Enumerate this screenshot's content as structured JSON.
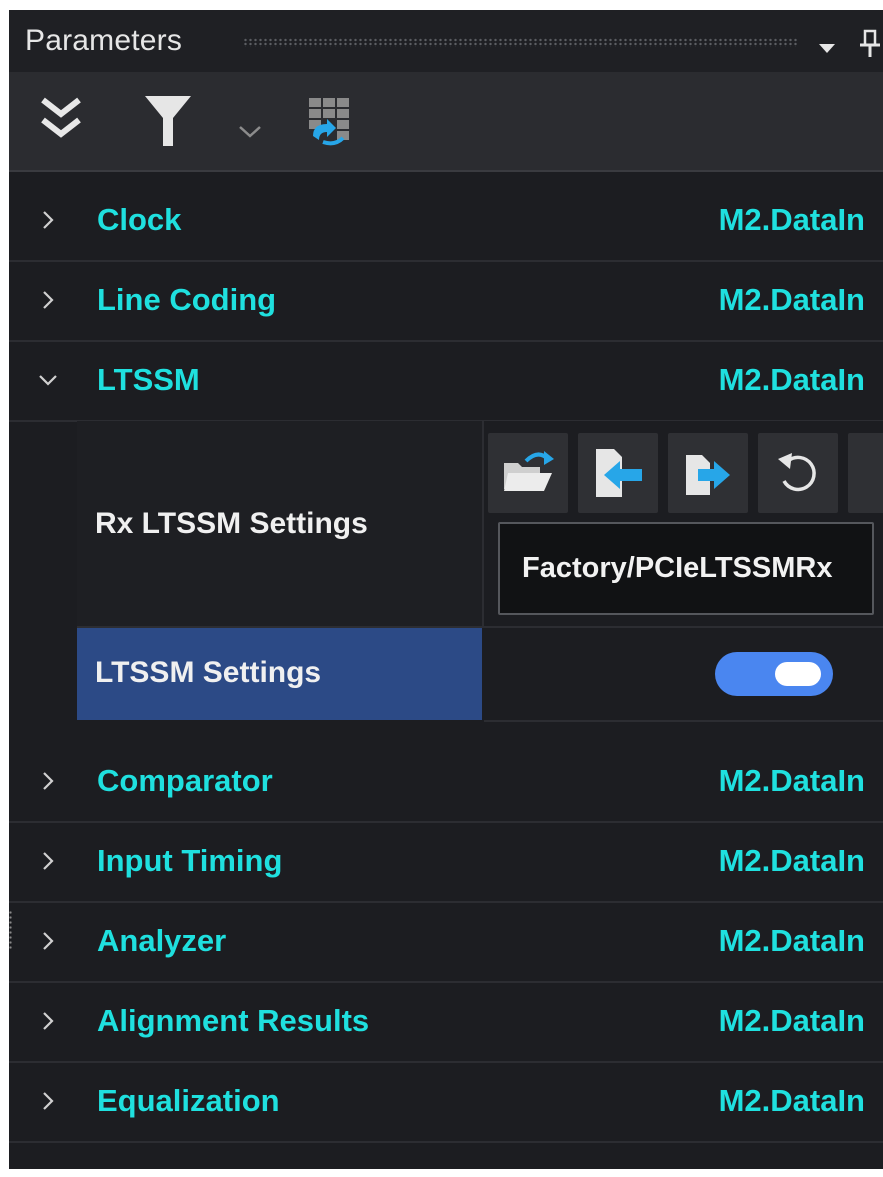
{
  "panel": {
    "title": "Parameters"
  },
  "toolbar": {
    "icons": [
      "expand-all-icon",
      "filter-icon",
      "chevron-down-icon",
      "refresh-grid-icon"
    ]
  },
  "tree": {
    "rows": [
      {
        "label": "Clock",
        "value": "M2.DataIn",
        "expanded": false
      },
      {
        "label": "Line Coding",
        "value": "M2.DataIn",
        "expanded": false
      },
      {
        "label": "LTSSM",
        "value": "M2.DataIn",
        "expanded": true
      },
      {
        "label": "Comparator",
        "value": "M2.DataIn",
        "expanded": false
      },
      {
        "label": "Input Timing",
        "value": "M2.DataIn",
        "expanded": false
      },
      {
        "label": "Analyzer",
        "value": "M2.DataIn",
        "expanded": false
      },
      {
        "label": "Alignment Results",
        "value": "M2.DataIn",
        "expanded": false
      },
      {
        "label": "Equalization",
        "value": "M2.DataIn",
        "expanded": false
      }
    ]
  },
  "ltssm": {
    "rx_settings": {
      "label": "Rx LTSSM Settings",
      "path": "Factory/PCIeLTSSMRx",
      "buttons": [
        "open-folder-icon",
        "import-icon",
        "export-icon",
        "reset-icon"
      ]
    },
    "settings": {
      "label": "LTSSM Settings",
      "enabled": true
    }
  },
  "colors": {
    "accent": "#1fe0df",
    "selected_row": "#2c4a86",
    "toggle_on": "#4a86f0",
    "background": "#1c1d21"
  }
}
